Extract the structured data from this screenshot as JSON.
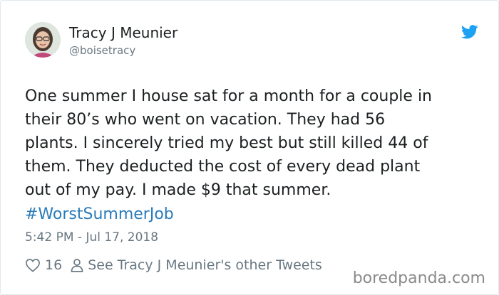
{
  "profile": {
    "display_name": "Tracy J Meunier",
    "handle": "@boisetracy"
  },
  "tweet": {
    "text": "One summer I house sat for a month for a couple in\ntheir 80’s who went on vacation. They had 56\nplants. I sincerely tried my best but still killed 44 of\nthem. They deducted the cost of every dead plant\nout of my pay. I made $9 that summer.",
    "hashtag": "#WorstSummerJob",
    "timestamp": "5:42 PM - Jul 17, 2018"
  },
  "actions": {
    "like_count": "16",
    "other_tweets_label": "See Tracy J Meunier's other Tweets"
  },
  "watermark": "boredpanda.com",
  "colors": {
    "link": "#2b7bb9",
    "twitter_blue": "#1da1f2",
    "muted": "#697882",
    "text": "#1c2022"
  },
  "icons": [
    "twitter-bird-icon",
    "heart-icon",
    "person-icon"
  ]
}
